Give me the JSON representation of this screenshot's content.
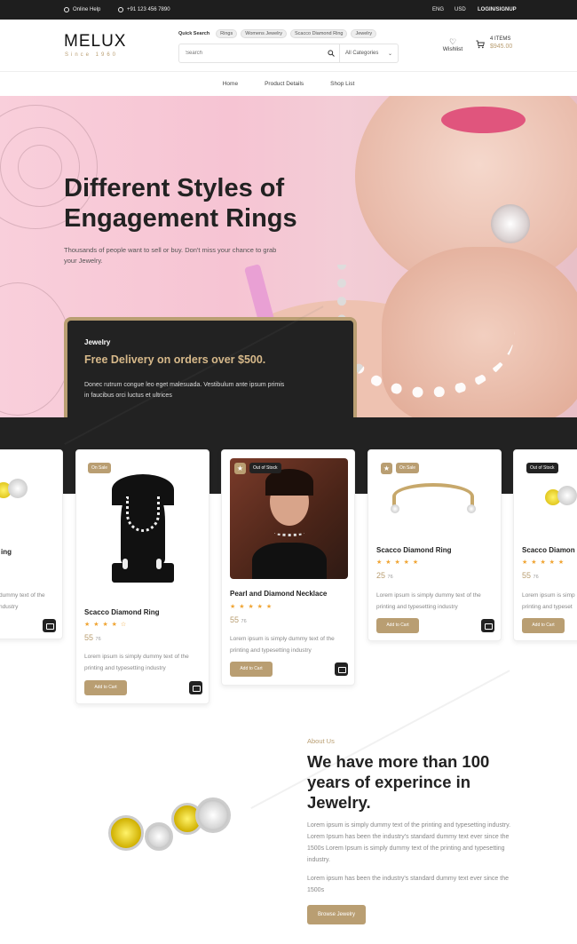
{
  "topbar": {
    "help": "Online Help",
    "phone": "+91 123 456 7890",
    "lang": "ENG",
    "currency": "USD",
    "login": "LOGIN/SIGNUP"
  },
  "brand": {
    "name": "MELUX",
    "since": "Since 1960"
  },
  "quick_search": {
    "label": "Quick Search",
    "chips": [
      "Rings",
      "Womens Jewelry",
      "Scacco Diamond Ring",
      "Jewelry"
    ]
  },
  "search": {
    "placeholder": "Search",
    "category": "All Categories"
  },
  "wishlist": {
    "label": "Wishlist"
  },
  "cart": {
    "items": "4 ITEMS",
    "amount": "$945.00"
  },
  "nav": [
    "Home",
    "Product Details",
    "Shop List"
  ],
  "hero": {
    "title": "Different Styles of Engagement Rings",
    "subtitle": "Thousands of people want to sell or buy. Don't miss your chance to grab your Jewelry.",
    "delivery": {
      "tag": "Jewelry",
      "offer": "Free Delivery on orders over $500.",
      "desc": "Donec rutrum congue leo eget malesuada. Vestibulum ante ipsum primis in faucibus orci luctus et ultrices"
    }
  },
  "products": [
    {
      "title": "ing",
      "badge": "",
      "stars": "",
      "price": "",
      "desc": "dummy text of the\nndustry"
    },
    {
      "title": "Scacco Diamond Ring",
      "badge": "On Sale",
      "stars": "★ ★ ★ ★ ☆",
      "price": "55",
      "desc": "Lorem ipsum is simply dummy text of the printing and typesetting industry",
      "cta": "Add to Cart"
    },
    {
      "title": "Pearl and Diamond Necklace",
      "badge": "Out of Stock",
      "stars": "★ ★ ★ ★ ★",
      "price": "55",
      "desc": "Lorem ipsum is simply dummy text of the printing and typesetting industry",
      "cta": "Add to Cart"
    },
    {
      "title": "Scacco Diamond Ring",
      "badge": "On Sale",
      "stars": "★ ★ ★ ★ ★",
      "price": "25",
      "desc": "Lorem ipsum is simply dummy text of the printing and typesetting industry",
      "cta": "Add to Cart"
    },
    {
      "title": "Scacco Diamon",
      "badge": "Out of Stock",
      "stars": "★ ★ ★ ★ ★",
      "price": "55",
      "desc": "Lorem ipsum is simp\nprinting and typeset",
      "cta": "Add to Cart"
    }
  ],
  "price_unit": "76",
  "about": {
    "eyebrow": "About Us",
    "title": "We have more than 100 years of experince in Jewelry.",
    "p1": "Lorem ipsum is simply dummy text of the printing and typesetting industry. Lorem Ipsum has been the industry's standard dummy text ever since the 1500s Lorem Ipsum is simply dummy text of the printing and typesetting industry.",
    "p2": "Lorem ipsum has been the industry's standard dummy text ever since the 1500s",
    "cta": "Browse Jewelry"
  },
  "colors": {
    "accent": "#b99e72",
    "dark": "#222222",
    "hero_bg": "#f7c9d6",
    "star": "#f0a534"
  }
}
